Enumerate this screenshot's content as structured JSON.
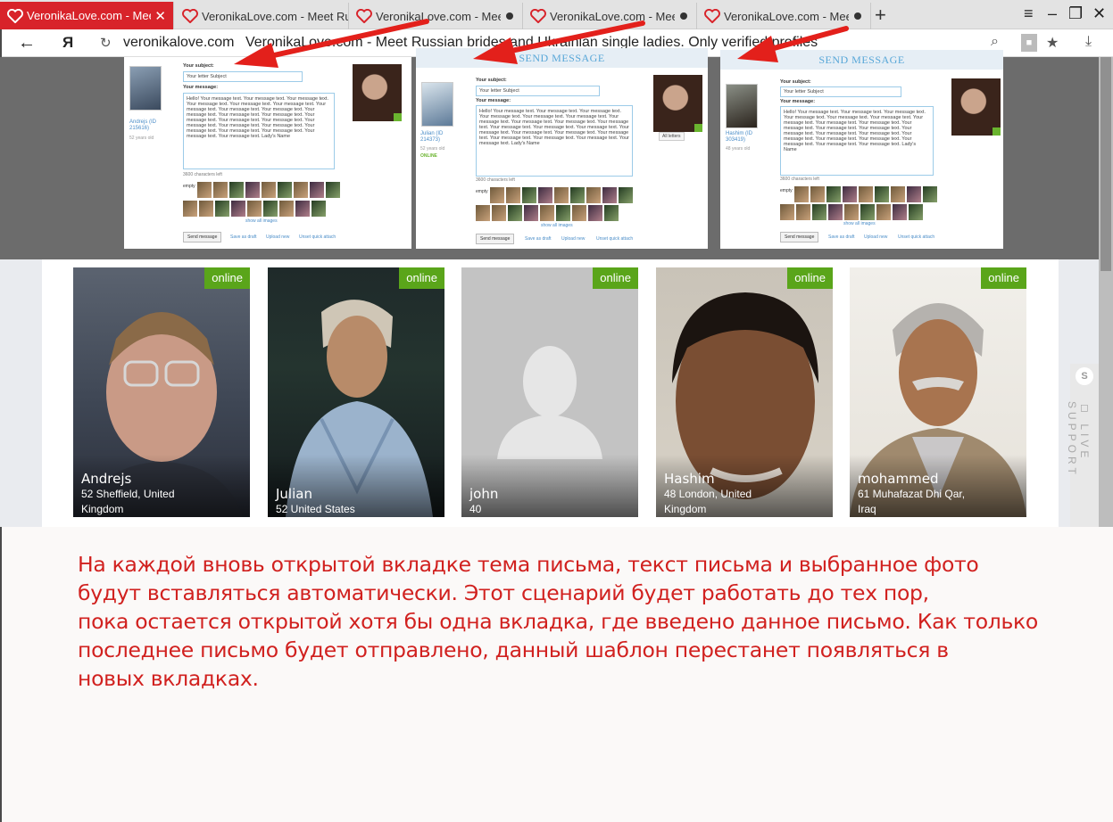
{
  "browser": {
    "tabs": [
      {
        "title": "VeronikaLove.com - Meet",
        "active": true,
        "close": "✕"
      },
      {
        "title": "VeronikaLove.com - Meet Ru"
      },
      {
        "title": "VeronikaLove.com - Meet"
      },
      {
        "title": "VeronikaLove.com - Meet"
      },
      {
        "title": "VeronikaLove.com - Meet"
      }
    ],
    "new_tab": "+",
    "controls": {
      "menu": "≡",
      "minimize": "–",
      "restore": "❐",
      "close": "✕"
    },
    "address": {
      "back": "←",
      "yandex": "Я",
      "reload": "↻",
      "domain": "veronikalove.com",
      "page_title": "VeronikaLove.com - Meet Russian brides and Ukrainian single ladies. Only verified profiles"
    },
    "icons": {
      "search": "⌕",
      "lock": "🔒",
      "star": "★",
      "download": "⤓"
    }
  },
  "screenshots": [
    {
      "subject_label": "Your subject:",
      "subject_value": "Your letter Subject",
      "message_label": "Your message:",
      "message": "Hello! Your message text. Your message text. Your message text. Your message text. Your message text. Your message text. Your message text. Your message text. Your message text. Your message text. Your message text. Your message text. Your message text. Your message text. Your message text. Your message text. Your message text. Your message text. Your message text. Your message text. Your message text. Your message text. Your message text. Lady's Name",
      "user_name": "Andrejs (ID 215616)",
      "user_age": "52 years old",
      "chars_left": "3600 characters left",
      "empty_label": "empty",
      "show_all": "show all images",
      "send": "Send message",
      "save_draft": "Save as draft",
      "upload": "Upload new",
      "unset": "Unset quick attach"
    },
    {
      "header": "SEND MESSAGE",
      "subject_label": "Your subject:",
      "subject_value": "Your letter Subject",
      "message_label": "Your message:",
      "message": "Hello! Your message text. Your message text. Your message text. Your message text. Your message text. Your message text. Your message text. Your message text. Your message text. Your message text. Your message text. Your message text. Your message text. Your message text. Your message text. Your message text. Your message text. Your message text. Your message text. Your message text. Your message text. Lady's Name",
      "user_name": "Julian (ID 214373)",
      "user_age": "52 years old",
      "online": "ONLINE",
      "all_letters": "All letters",
      "chars_left": "3600 characters left",
      "empty_label": "empty",
      "show_all": "show all images",
      "send": "Send message",
      "save_draft": "Save as draft",
      "upload": "Upload new",
      "unset": "Unset quick attach"
    },
    {
      "header": "SEND MESSAGE",
      "subject_label": "Your subject:",
      "subject_value": "Your letter Subject",
      "message_label": "Your message:",
      "message": "Hello! Your message text. Your message text. Your message text. Your message text. Your message text. Your message text. Your message text. Your message text. Your message text. Your message text. Your message text. Your message text. Your message text. Your message text. Your message text. Your message text. Your message text. Your message text. Your message text. Your message text. Your message text. Lady's Name",
      "user_name": "Hashim (ID 303419)",
      "user_age": "48 years old",
      "chars_left": "3600 characters left",
      "empty_label": "empty",
      "show_all": "show all images",
      "send": "Send message",
      "save_draft": "Save as draft",
      "upload": "Upload new",
      "unset": "Unset quick attach"
    }
  ],
  "profiles": [
    {
      "name": "Andrejs",
      "info": "52 Sheffield, United Kingdom",
      "status": "online"
    },
    {
      "name": "Julian",
      "info": "52 United States",
      "status": "online"
    },
    {
      "name": "john",
      "info": "40",
      "status": "online"
    },
    {
      "name": "Hashim",
      "info": "48 London, United Kingdom",
      "status": "online"
    },
    {
      "name": "mohammed",
      "info": "61 Muhafazat Dhi Qar, Iraq",
      "status": "online"
    }
  ],
  "live_support": {
    "icon": "S",
    "label": "◻ LIVE SUPPORT"
  },
  "caption": [
    "На каждой вновь открытой вкладке тема письма, текст письма и выбранное фото",
    "будут вставляться автоматически. Этот сценарий будет работать до тех пор,",
    "пока остается открытой хотя бы одна вкладка, где введено данное письмо. Как только",
    "последнее письмо будет отправлено, данный шаблон перестанет появляться в",
    "новых вкладках."
  ],
  "colors": {
    "accent": "#d8232a",
    "online": "#5aa51a",
    "caption": "#d1211f",
    "link": "#4a8dc8"
  }
}
